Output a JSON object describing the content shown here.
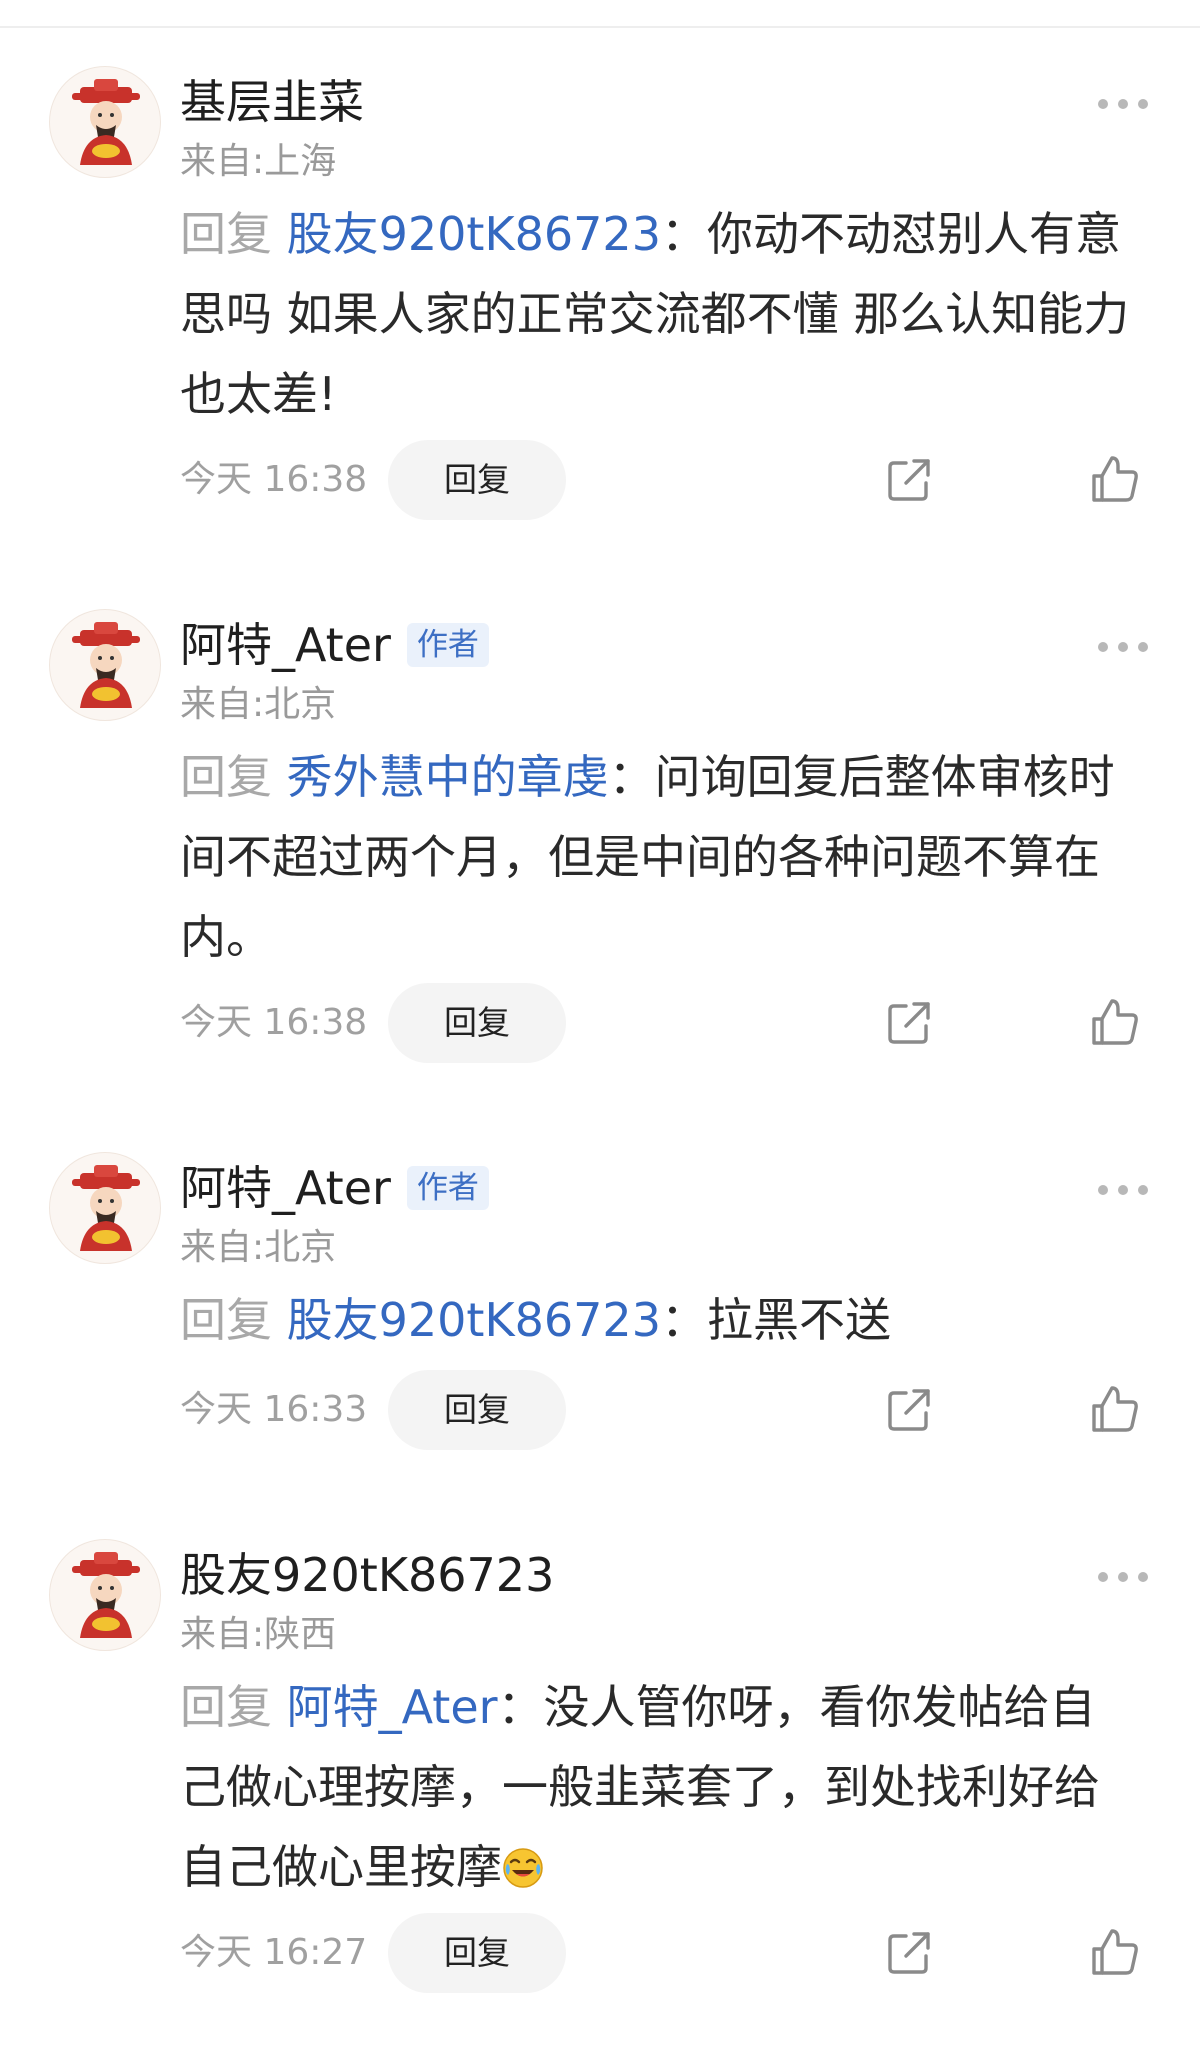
{
  "colors": {
    "mention": "#3468c0",
    "reply_prefix": "#a8a8a8",
    "author_badge_bg": "#eaf1fb",
    "author_badge_text": "#3d6fc4",
    "reply_button_bg": "#f4f4f4",
    "meta_text": "#a0a0a0"
  },
  "icons": {
    "avatar": "caishen-avatar-icon",
    "more": "more-dots-icon",
    "share": "share-icon",
    "like": "thumbs-up-icon",
    "emoji": "laugh-cry-emoji-icon"
  },
  "comments": [
    {
      "user": "基层韭菜",
      "is_author": false,
      "location": "来自:上海",
      "reply_prefix": "回复 ",
      "mention": "股友920tK86723",
      "text": "：你动不动怼别人有意思吗 如果人家的正常交流都不懂 那么认知能力也太差!",
      "time": "今天 16:38",
      "reply_label": "回复"
    },
    {
      "user": "阿特_Ater",
      "is_author": true,
      "author_badge": "作者",
      "location": "来自:北京",
      "reply_prefix": "回复 ",
      "mention": "秀外慧中的章虔",
      "text": "：问询回复后整体审核时间不超过两个月，但是中间的各种问题不算在内。",
      "time": "今天 16:38",
      "reply_label": "回复"
    },
    {
      "user": "阿特_Ater",
      "is_author": true,
      "author_badge": "作者",
      "location": "来自:北京",
      "reply_prefix": "回复 ",
      "mention": "股友920tK86723",
      "text": "：拉黑不送",
      "time": "今天 16:33",
      "reply_label": "回复"
    },
    {
      "user": "股友920tK86723",
      "is_author": false,
      "location": "来自:陕西",
      "reply_prefix": "回复 ",
      "mention": "阿特_Ater",
      "text": "：没人管你呀，看你发帖给自己做心理按摩，一般韭菜套了，到处找利好给自己做心里按摩",
      "time": "今天 16:27",
      "reply_label": "回复"
    }
  ]
}
